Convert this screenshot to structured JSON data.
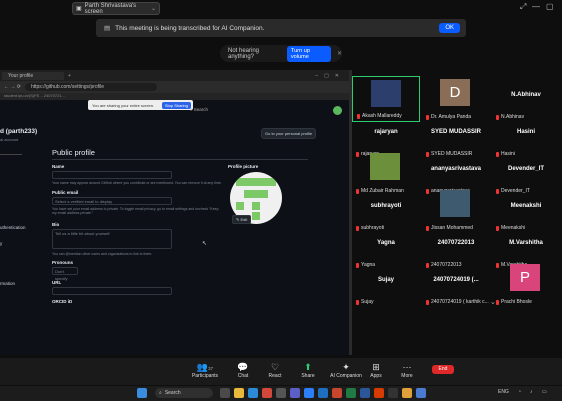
{
  "sharing_tag": {
    "label": "Parth Shrivastava's screen"
  },
  "banner": {
    "text": "This meeting is being transcribed for AI Companion.",
    "ok_label": "OK"
  },
  "audio_prompt": {
    "text": "Not hearing anything?",
    "button": "Turn up volume"
  },
  "browser": {
    "tab_title": "Your profile",
    "url": "https://github.com/settings/profile",
    "bookmark_text": "student.lpu.in/(S(FE... 24070721...",
    "share_notice": "You are sharing your entire screen.",
    "stop_sharing": "Stop Sharing",
    "search_text": "Search",
    "user_heading": "d (parth233)",
    "user_sub": "al account",
    "go_profile": "Go to your personal profile",
    "section_title": "Public profile",
    "sidebar_items": [
      "uthentication",
      "y",
      "rmation"
    ],
    "fields": {
      "name_label": "Name",
      "name_help": "Your name may appear around GitHub where you contribute or are mentioned. You can remove it at any time.",
      "email_label": "Public email",
      "email_value": "Select a verified email to display",
      "email_help": "You have set your email address to private. To toggle email privacy, go to email settings and uncheck \"Keep my email address private.\"",
      "bio_label": "Bio",
      "bio_placeholder": "Tell us a little bit about yourself",
      "bio_help": "You can @mention other users and organizations to link to them.",
      "pronouns_label": "Pronouns",
      "pronouns_value": "Don't specify",
      "url_label": "URL",
      "orcid_label": "ORCID iD"
    },
    "profile_picture_label": "Profile picture",
    "edit_label": "Edit"
  },
  "participants": [
    {
      "big": "",
      "name": "Akash Mallareddy",
      "tile": "photo",
      "active": true
    },
    {
      "big": "",
      "name": "Dr. Amulya Panda",
      "tile": "letter",
      "letter": "D",
      "letter_color": "#8a6d57"
    },
    {
      "big": "N.Abhinav",
      "name": "N.Abhinav"
    },
    {
      "big": "rajaryan",
      "name": "rajaryan"
    },
    {
      "big": "SYED MUDASSIR",
      "name": "SYED MUDASSIR"
    },
    {
      "big": "Hasini",
      "name": "Hasini"
    },
    {
      "big": "",
      "name": "Md Zubair Rahman",
      "tile": "photo2"
    },
    {
      "big": "ananyasrivastava",
      "name": "ananyasrivastava"
    },
    {
      "big": "Devender_IT",
      "name": "Devender_IT"
    },
    {
      "big": "subhrayoti",
      "name": "subhrayoti"
    },
    {
      "big": "",
      "name": "Jissan Mohammed",
      "tile": "photo3"
    },
    {
      "big": "Meenakshi",
      "name": "Meenakshi"
    },
    {
      "big": "Yagna",
      "name": "Yagna"
    },
    {
      "big": "24070722013",
      "name": "24070722013"
    },
    {
      "big": "M.Varshitha",
      "name": "M.Varshitha"
    },
    {
      "big": "Sujay",
      "name": "Sujay"
    },
    {
      "big": "24070724019 (...",
      "name": "24070724019 ( karthik c..."
    },
    {
      "big": "",
      "name": "Prachi Bhosle",
      "tile": "letter",
      "letter": "P",
      "letter_color": "#d9457a"
    }
  ],
  "toolbar": {
    "participants_count": "37",
    "items": [
      "Participants",
      "Chat",
      "React",
      "Share",
      "AI Companion",
      "Apps",
      "More"
    ],
    "leave": "End"
  },
  "taskbar": {
    "search": "Search",
    "time": "",
    "lang": "ENG"
  }
}
